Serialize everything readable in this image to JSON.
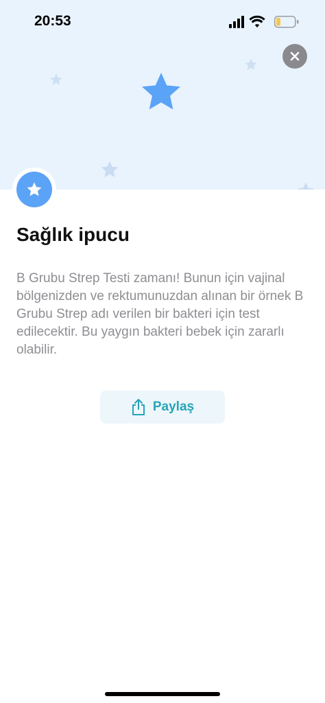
{
  "status_bar": {
    "time": "20:53",
    "icons": [
      "cellular-signal-icon",
      "wifi-icon",
      "battery-icon"
    ]
  },
  "header": {
    "close_icon": "close-icon",
    "decoration_icon": "star-icon"
  },
  "tip": {
    "badge_icon": "star-icon",
    "title": "Sağlık ipucu",
    "body": "B Grubu Strep Testi zamanı! Bunun için vajinal bölgenizden ve rektumunuzdan alınan bir örnek B Grubu Strep adı verilen bir bakteri için test edilecektir. Bu yaygın bakteri bebek için zararlı olabilir."
  },
  "share": {
    "label": "Paylaş",
    "icon": "share-icon"
  },
  "colors": {
    "hero_background": "#e9f3fe",
    "star_main": "#5ba3f6",
    "star_faint": "#bcd6f3",
    "share_text": "#27a3b8",
    "share_background": "#edf6fb",
    "body_text": "#8e8e93"
  }
}
